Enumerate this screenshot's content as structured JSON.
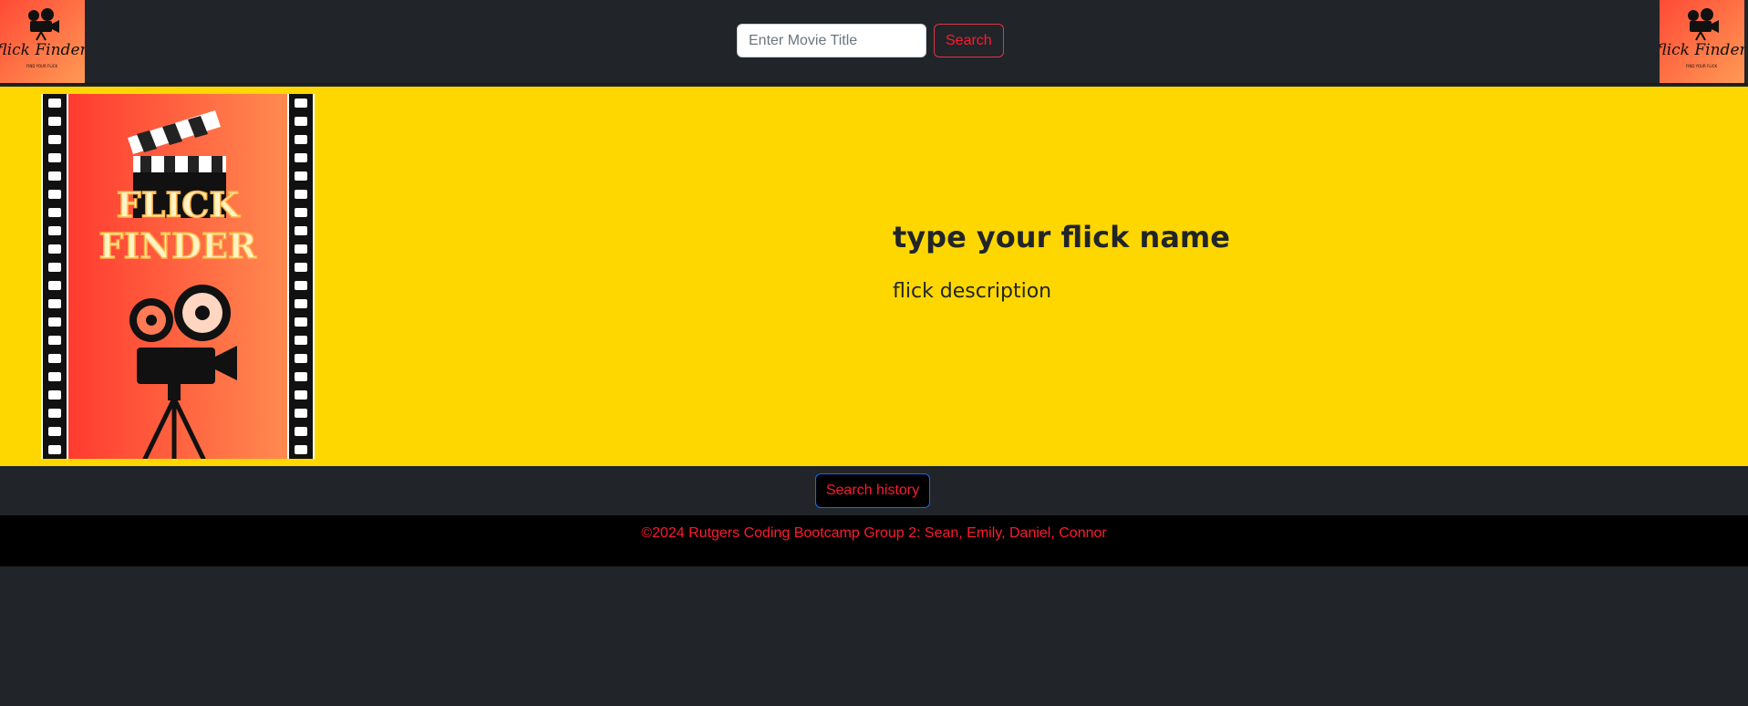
{
  "header": {
    "logo_left_icon": "flick-finder-logo",
    "logo_right_icon": "flick-finder-logo",
    "search": {
      "placeholder": "Enter Movie Title",
      "value": "",
      "button_label": "Search"
    }
  },
  "hero": {
    "poster_icon": "flick-finder-poster",
    "poster_text_line1": "FLICK",
    "poster_text_line2": "FINDER",
    "title": "type your flick name",
    "description": "flick description"
  },
  "history": {
    "button_label": "Search history"
  },
  "footer": {
    "text": "©2024 Rutgers Coding Bootcamp Group 2: Sean, Emily, Daniel, Connor"
  },
  "colors": {
    "page_bg": "#212529",
    "hero_bg": "#ffd700",
    "accent_red": "#ff1a2e",
    "history_border": "#0d6efd",
    "poster_gradient_start": "#ff3b30",
    "poster_gradient_end": "#ff8a50"
  }
}
